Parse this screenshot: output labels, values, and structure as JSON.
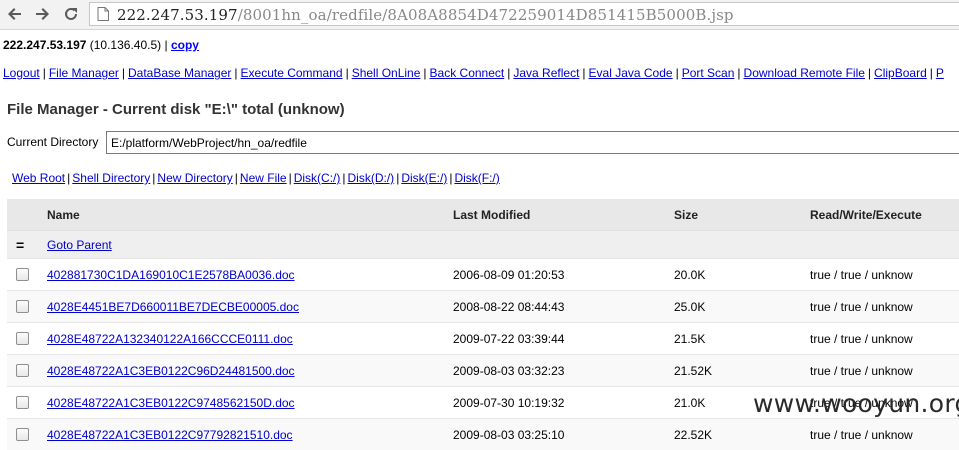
{
  "browser": {
    "url_host": "222.247.53.197",
    "url_path": "/8001hn_oa/redfile/8A08A8854D472259014D851415B5000B.jsp",
    "icons": [
      "back-arrow-icon",
      "forward-arrow-icon",
      "reload-icon",
      "page-icon"
    ]
  },
  "header": {
    "ip": "222.247.53.197",
    "internal_ip": " (10.136.40.5) | ",
    "copy_label": "copy"
  },
  "menu": {
    "items": [
      "Logout",
      "File Manager",
      "DataBase Manager",
      "Execute Command",
      "Shell OnLine",
      "Back Connect",
      "Java Reflect",
      "Eval Java Code",
      "Port Scan",
      "Download Remote File",
      "ClipBoard",
      "P"
    ]
  },
  "file_manager": {
    "title": "File Manager - Current disk \"E:\\\" total (unknow)",
    "current_dir_label": "Current Directory",
    "current_dir_value": "E:/platform/WebProject/hn_oa/redfile",
    "toolbar": [
      "Web Root",
      "Shell Directory",
      "New Directory",
      "New File",
      "Disk(C:/)",
      "Disk(D:/)",
      "Disk(E:/)",
      "Disk(F:/)"
    ]
  },
  "table": {
    "columns": [
      "Name",
      "Last Modified",
      "Size",
      "Read/Write/Execute"
    ],
    "parent_icon": "=",
    "parent_label": "Goto Parent",
    "rows": [
      {
        "name": "402881730C1DA169010C1E2578BA0036.doc",
        "modified": "2006-08-09 01:20:53",
        "size": "20.0K",
        "rwx": "true / true / unknow"
      },
      {
        "name": "4028E4451BE7D660011BE7DECBE00005.doc",
        "modified": "2008-08-22 08:44:43",
        "size": "25.0K",
        "rwx": "true / true / unknow"
      },
      {
        "name": "4028E48722A132340122A166CCCE0111.doc",
        "modified": "2009-07-22 03:39:44",
        "size": "21.5K",
        "rwx": "true / true / unknow"
      },
      {
        "name": "4028E48722A1C3EB0122C96D24481500.doc",
        "modified": "2009-08-03 03:32:23",
        "size": "21.52K",
        "rwx": "true / true / unknow"
      },
      {
        "name": "4028E48722A1C3EB0122C9748562150D.doc",
        "modified": "2009-07-30 10:19:32",
        "size": "21.0K",
        "rwx": "true / true / unknow"
      },
      {
        "name": "4028E48722A1C3EB0122C97792821510.doc",
        "modified": "2009-08-03 03:25:10",
        "size": "22.52K",
        "rwx": "true / true / unknow"
      }
    ]
  },
  "watermark": "www.wooyun.org",
  "colors": {
    "link": "#0000cc",
    "header_bg": "#e8e8e8",
    "chrome_bg": "#f2f2f2"
  }
}
